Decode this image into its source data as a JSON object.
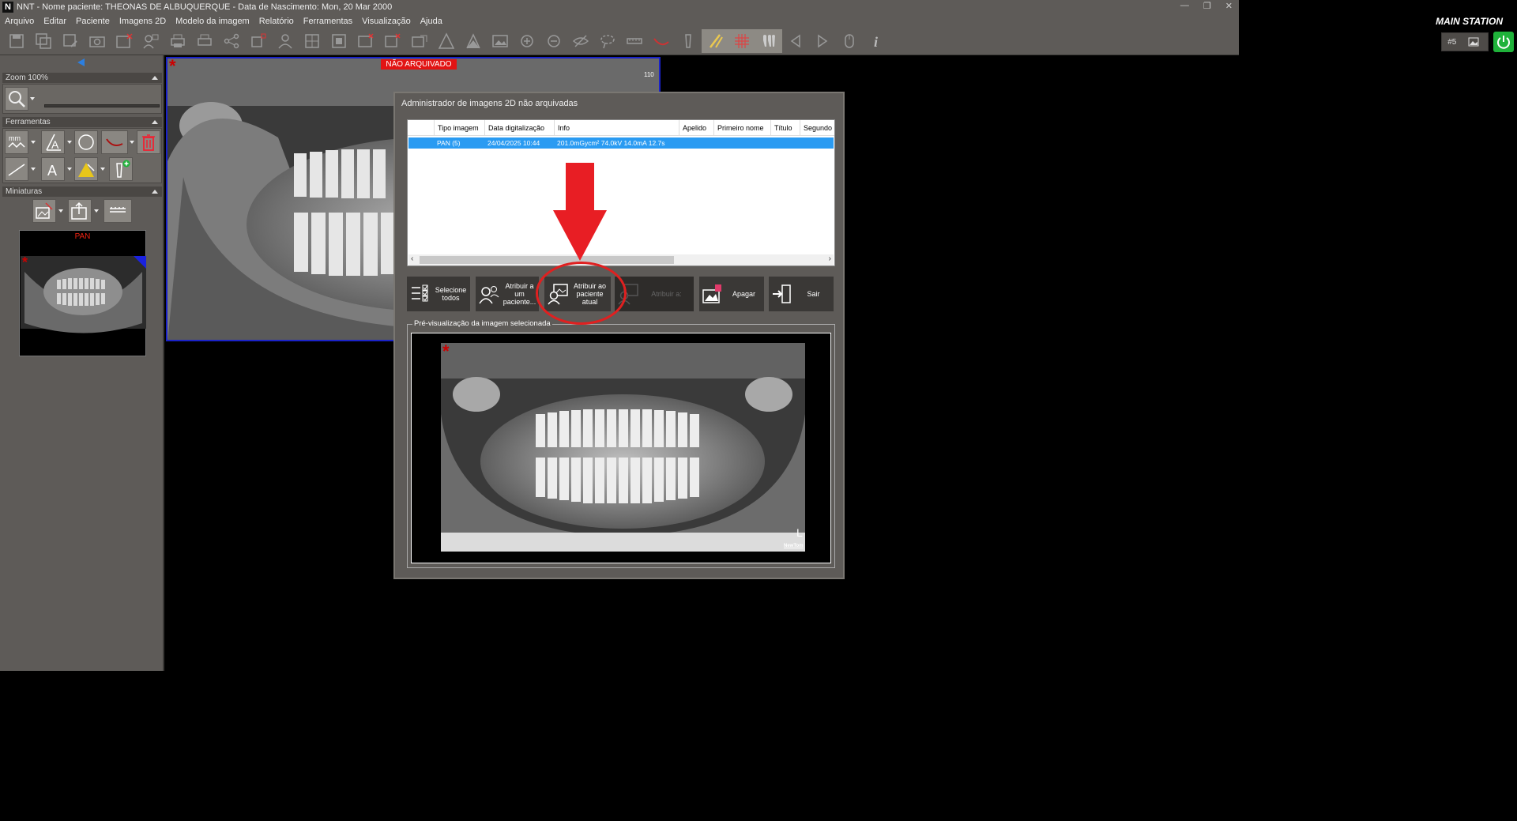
{
  "window": {
    "title": "NNT - Nome paciente: THEONAS DE ALBUQUERQUE - Data de Nascimento: Mon, 20 Mar 2000",
    "logo": "N",
    "station": "MAIN STATION",
    "station_number": "#5"
  },
  "menu": [
    "Arquivo",
    "Editar",
    "Paciente",
    "Imagens 2D",
    "Modelo da imagem",
    "Relatório",
    "Ferramentas",
    "Visualização",
    "Ajuda"
  ],
  "toolbar": {
    "icons": [
      "save-icon",
      "save-all-icon",
      "save-as-icon",
      "camera-icon",
      "close-image-icon",
      "assign-patient-icon",
      "print-icon",
      "print-preview-icon",
      "share-icon",
      "delete-image-icon",
      "patient-icon",
      "crop-icon",
      "frame-icon",
      "image-delete-icon",
      "delete-multiple-icon",
      "export-icon",
      "sharpen-icon",
      "contrast-icon",
      "image-icon",
      "zoom-in-icon",
      "zoom-out-icon",
      "hide-icon",
      "lasso-icon",
      "ruler-icon",
      "nerve-icon",
      "implant-icon",
      "pencil-icon",
      "grid-icon",
      "teeth-icon",
      "prev-icon",
      "next-icon",
      "mouse-icon",
      "info-icon"
    ]
  },
  "left_panel": {
    "zoom_header": "Zoom 100%",
    "zoom_level": 0.5,
    "tools_header": "Ferramentas",
    "thumbs_header": "Miniaturas",
    "thumbnail_label": "PAN"
  },
  "viewer": {
    "badge": "NÃO ARQUIVADO",
    "image_number": "110"
  },
  "dialog": {
    "title": "Administrador de imagens 2D não arquivadas",
    "columns": [
      "Tipo imagem",
      "Data digitalização",
      "Info",
      "Apelido",
      "Primeiro nome",
      "Título",
      "Segundo n"
    ],
    "rows": [
      {
        "type": "PAN (5)",
        "date": "24/04/2025 10:44",
        "info": "201.0mGycm² 74.0kV 14.0mA 12.7s"
      }
    ],
    "buttons": {
      "select_all": "Selecione todos",
      "assign_patient": "Atribuir a um paciente...",
      "assign_current": "Atribuir ao paciente atual",
      "assign_to": "Atribuir a:",
      "delete": "Apagar",
      "exit": "Sair"
    },
    "preview_label": "Pré-visualização da imagem selecionada",
    "preview_side": "L",
    "preview_brand": "NewTom"
  },
  "colors": {
    "panel": "#5e5b58",
    "selection": "#2a9bf2",
    "annotation": "#e02020",
    "power": "#1fb23a"
  }
}
